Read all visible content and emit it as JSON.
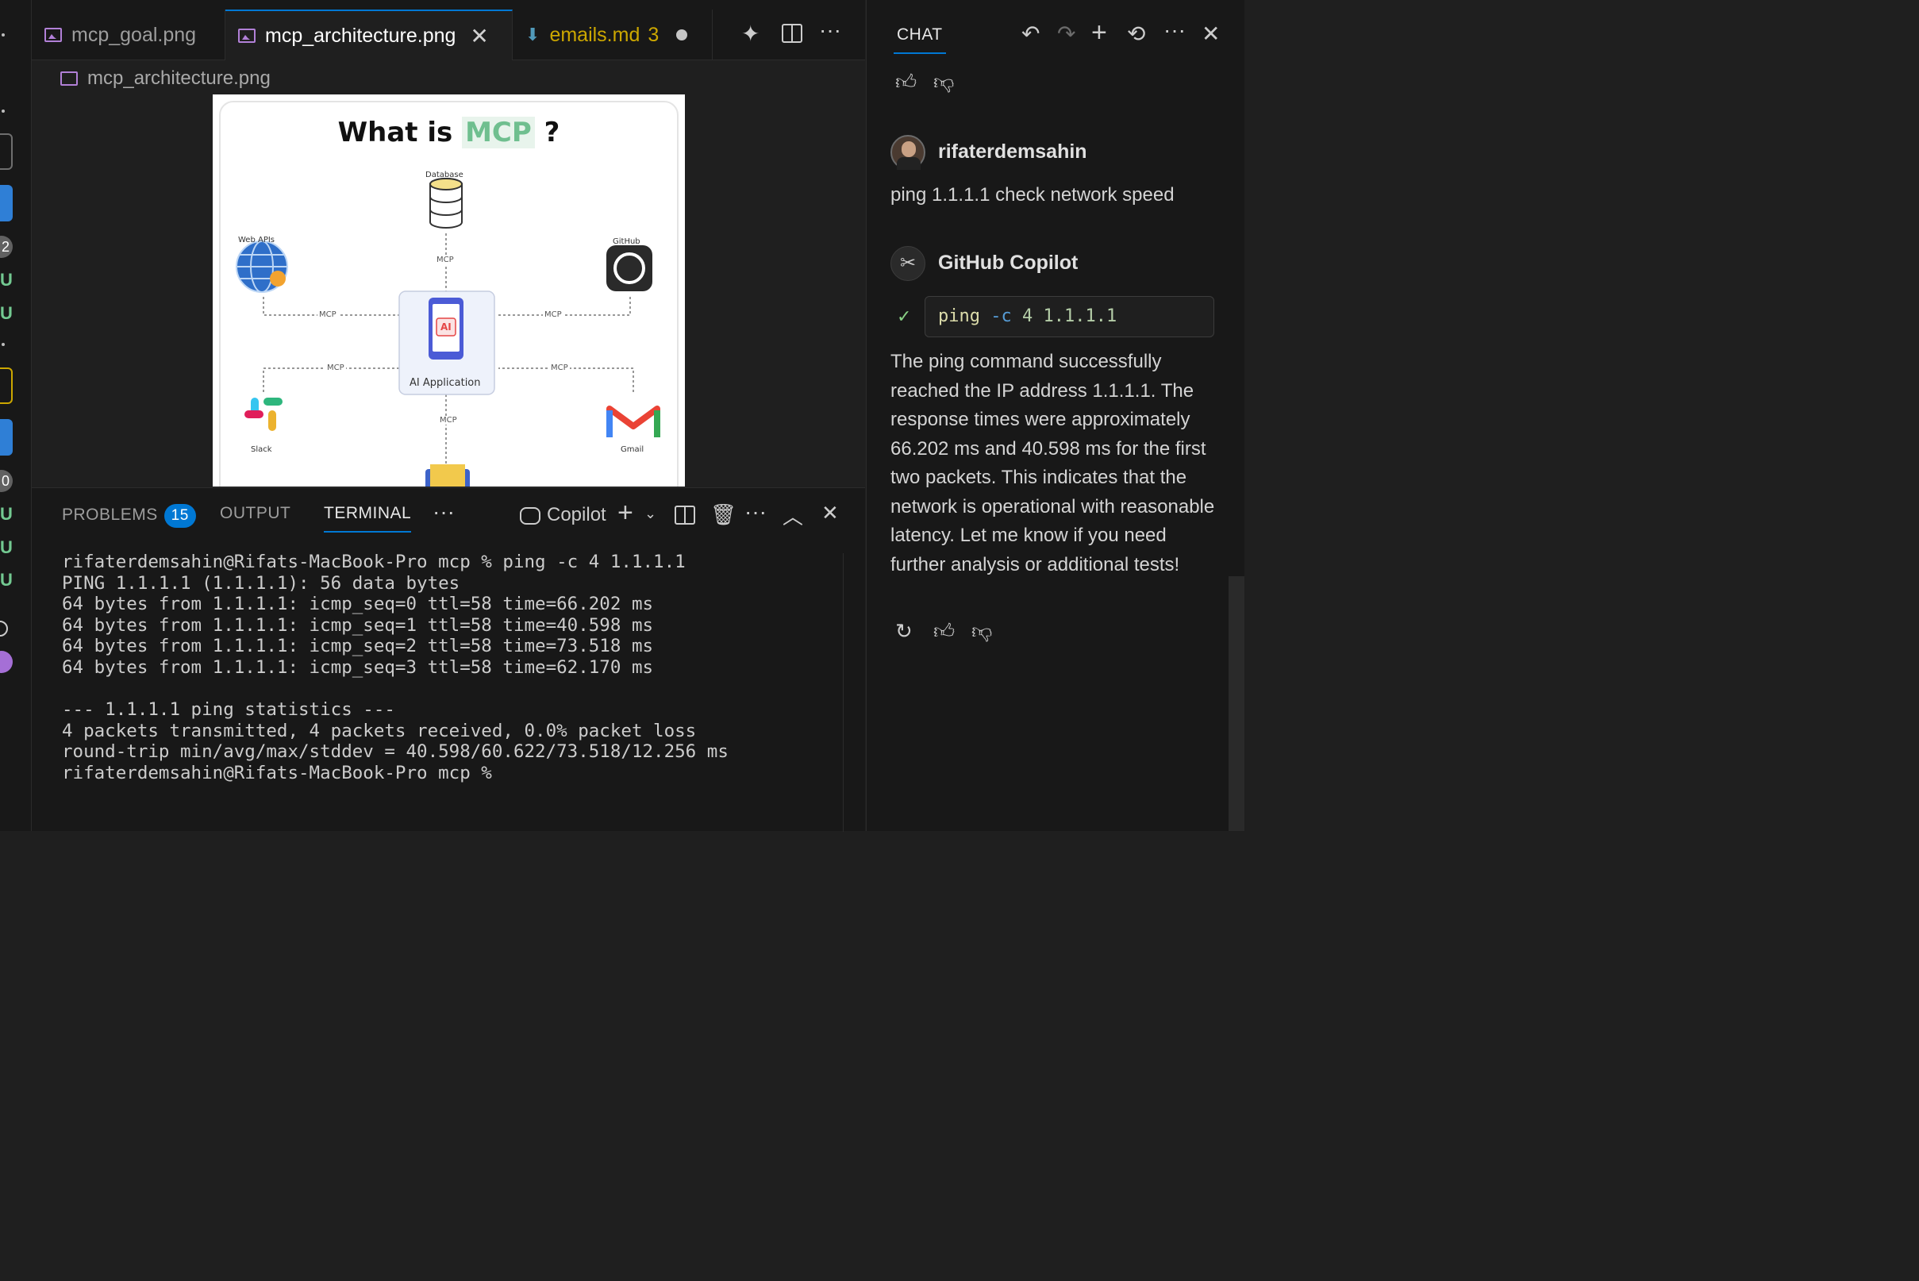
{
  "tabs": [
    {
      "label": "mcp_goal.png",
      "active": false
    },
    {
      "label": "mcp_architecture.png",
      "active": true
    },
    {
      "label": "emails.md",
      "problem_count": "3",
      "modified": true
    }
  ],
  "breadcrumb": {
    "label": "mcp_architecture.png"
  },
  "diagram": {
    "title_part1": "What is ",
    "title_highlight": "MCP",
    "title_part2": " ?",
    "center_label": "AI Application",
    "center_chip": "AI",
    "nodes": {
      "database": "Database",
      "web_apis": "Web APIs",
      "github": "GitHub",
      "slack": "Slack",
      "gmail": "Gmail"
    },
    "connector_label": "MCP"
  },
  "panel": {
    "tabs": {
      "problems": "PROBLEMS",
      "problems_count": "15",
      "output": "OUTPUT",
      "terminal": "TERMINAL"
    },
    "terminal_profile": "Copilot",
    "terminal_lines": [
      "rifaterdemsahin@Rifats-MacBook-Pro mcp % ping -c 4 1.1.1.1",
      "PING 1.1.1.1 (1.1.1.1): 56 data bytes",
      "64 bytes from 1.1.1.1: icmp_seq=0 ttl=58 time=66.202 ms",
      "64 bytes from 1.1.1.1: icmp_seq=1 ttl=58 time=40.598 ms",
      "64 bytes from 1.1.1.1: icmp_seq=2 ttl=58 time=73.518 ms",
      "64 bytes from 1.1.1.1: icmp_seq=3 ttl=58 time=62.170 ms",
      "",
      "--- 1.1.1.1 ping statistics ---",
      "4 packets transmitted, 4 packets received, 0.0% packet loss",
      "round-trip min/avg/max/stddev = 40.598/60.622/73.518/12.256 ms",
      "rifaterdemsahin@Rifats-MacBook-Pro mcp %"
    ]
  },
  "chat": {
    "title": "CHAT",
    "user": {
      "name": "rifaterdemsahin",
      "message": "ping 1.1.1.1 check network speed"
    },
    "assistant": {
      "name": "GitHub Copilot",
      "command_program": "ping",
      "command_flag": "-c",
      "command_args": "4 1.1.1.1",
      "reply": "The ping command successfully reached the IP address 1.1.1.1. The response times were approximately 66.202 ms and 40.598 ms for the first two packets. This indicates that the network is operational with reasonable latency. Let me know if you need further analysis or additional tests!"
    }
  },
  "activity_badges": [
    "2",
    "0"
  ],
  "colors": {
    "accent": "#0078d4",
    "editor_bg": "#1f1f1f",
    "sidebar_bg": "#181818",
    "warning": "#cca700",
    "git_added": "#73c991",
    "success": "#89d185"
  }
}
